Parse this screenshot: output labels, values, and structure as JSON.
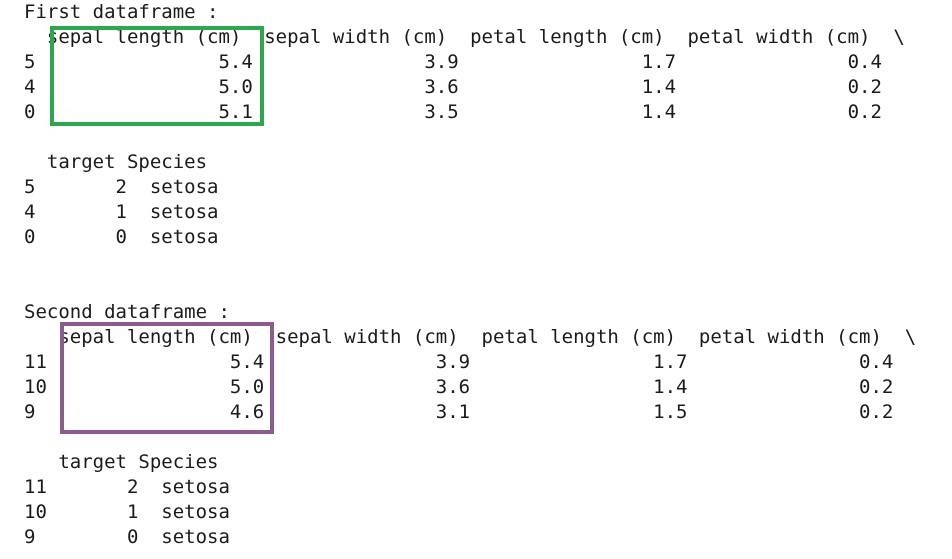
{
  "first": {
    "heading": "First dataframe :",
    "header_line": "  sepal length (cm)  sepal width (cm)  petal length (cm)  petal width (cm)  \\",
    "rows": [
      "5                5.4               3.9                1.7               0.4",
      "4                5.0               3.6                1.4               0.2",
      "0                5.1               3.5                1.4               0.2"
    ],
    "sub_header": "  target Species",
    "sub_rows": [
      "5       2  setosa",
      "4       1  setosa",
      "0       0  setosa"
    ],
    "box_color": "#2ea84f"
  },
  "second": {
    "heading": "Second dataframe :",
    "header_line": "   sepal length (cm)  sepal width (cm)  petal length (cm)  petal width (cm)  \\",
    "rows": [
      "11                5.4               3.9                1.7               0.4",
      "10                5.0               3.6                1.4               0.2",
      "9                 4.6               3.1                1.5               0.2"
    ],
    "sub_header": "   target Species",
    "sub_rows": [
      "11       2  setosa",
      "10       1  setosa",
      "9        0  setosa"
    ],
    "box_color": "#8a5d8f"
  }
}
